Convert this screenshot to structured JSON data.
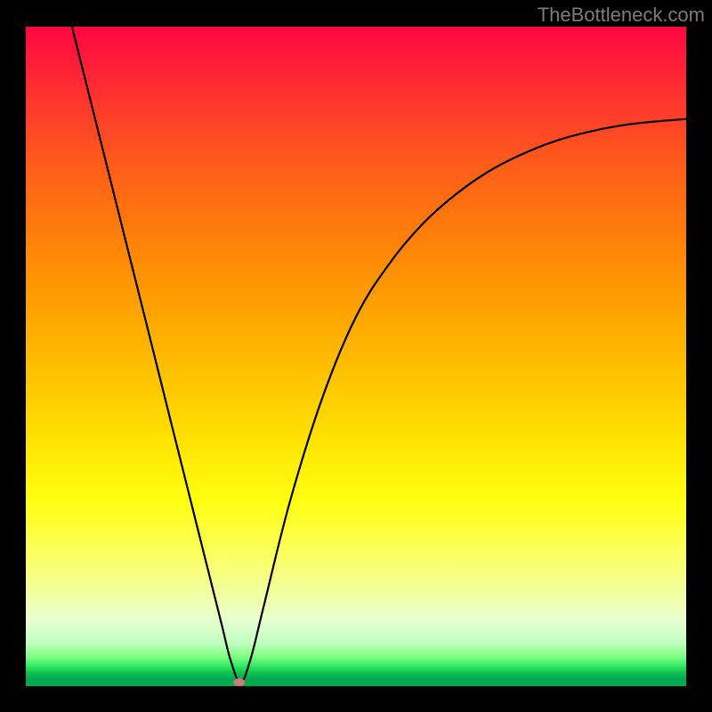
{
  "watermark": "TheBottleneck.com",
  "chart_data": {
    "type": "line",
    "title": "",
    "xlabel": "",
    "ylabel": "",
    "xlim": [
      0,
      100
    ],
    "ylim": [
      0,
      100
    ],
    "series": [
      {
        "name": "bottleneck-curve",
        "x": [
          7,
          10,
          14,
          18,
          22,
          26,
          29.5,
          31,
          32.5,
          34,
          36,
          40,
          45,
          50,
          55,
          60,
          65,
          70,
          75,
          80,
          85,
          90,
          95,
          100
        ],
        "y": [
          100,
          88,
          72,
          56,
          40,
          24,
          10,
          4,
          0.6,
          4,
          12,
          28,
          44,
          56,
          64,
          70,
          74.5,
          78,
          80.6,
          82.6,
          84,
          85,
          85.6,
          86
        ]
      }
    ],
    "marker": {
      "x": 32.3,
      "y": 0.6,
      "color": "#cc7b7e"
    },
    "background_gradient": {
      "type": "vertical",
      "stops": [
        {
          "pos": 0.0,
          "color": "#ff0640"
        },
        {
          "pos": 0.32,
          "color": "#ff8008"
        },
        {
          "pos": 0.62,
          "color": "#ffe000"
        },
        {
          "pos": 0.8,
          "color": "#fcff60"
        },
        {
          "pos": 0.95,
          "color": "#80ff80"
        },
        {
          "pos": 1.0,
          "color": "#00a850"
        }
      ]
    }
  }
}
